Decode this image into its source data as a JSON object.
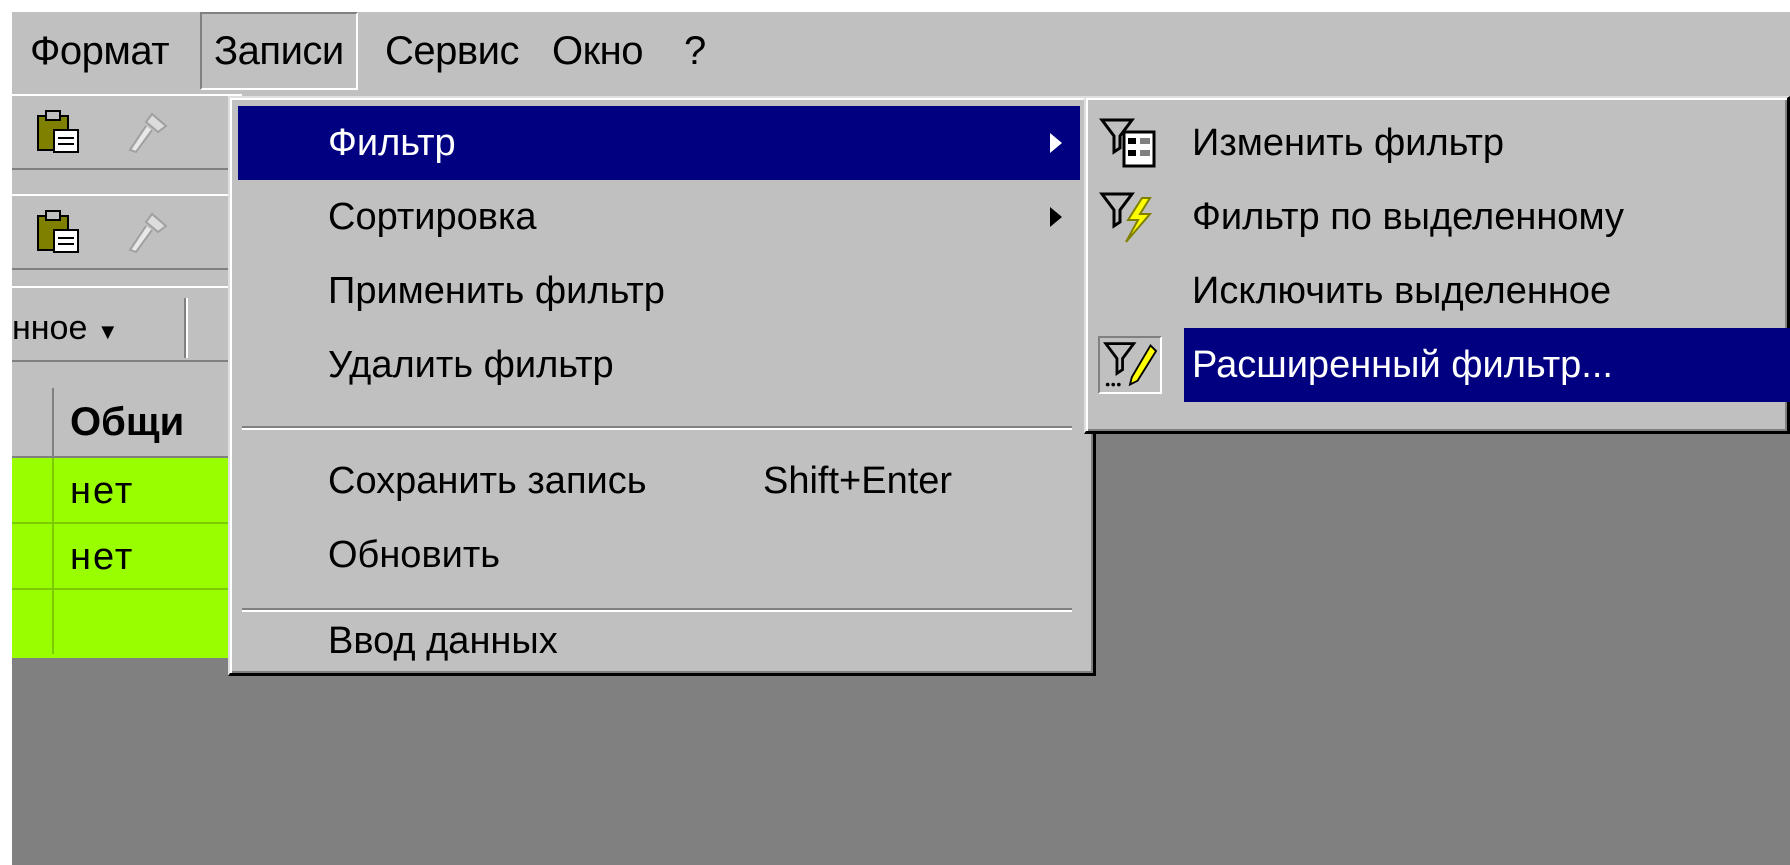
{
  "menubar": {
    "items": [
      {
        "label": "Формат",
        "accel_index": 3
      },
      {
        "label": "Записи",
        "accel_index": 0
      },
      {
        "label": "Сервис",
        "accel_index": 0
      },
      {
        "label": "Окно",
        "accel_index": 0
      },
      {
        "label": "?",
        "accel_index": 0
      }
    ]
  },
  "toolbar": {
    "combo_label": "нное"
  },
  "grid": {
    "header": "Общи",
    "rows": [
      "нет",
      "нет",
      ""
    ],
    "row_color": "#99ff00"
  },
  "records_menu": {
    "items": [
      {
        "label": "Фильтр",
        "has_submenu": true
      },
      {
        "label": "Сортировка",
        "has_submenu": true
      },
      {
        "label": "Применить фильтр"
      },
      {
        "label": "Удалить фильтр"
      },
      {
        "label": "Сохранить запись",
        "shortcut": "Shift+Enter"
      },
      {
        "label": "Обновить"
      },
      {
        "label": "Ввод данных"
      }
    ]
  },
  "filter_submenu": {
    "items": [
      {
        "label": "Изменить фильтр",
        "icon": "filter-form-icon"
      },
      {
        "label": "Фильтр по выделенному",
        "icon": "filter-selection-icon"
      },
      {
        "label": "Исключить выделенное",
        "icon": ""
      },
      {
        "label": "Расширенный фильтр...",
        "icon": "advanced-filter-icon"
      }
    ]
  },
  "colors": {
    "highlight": "#000080",
    "face": "#c0c0c0",
    "workspace": "#808080"
  }
}
